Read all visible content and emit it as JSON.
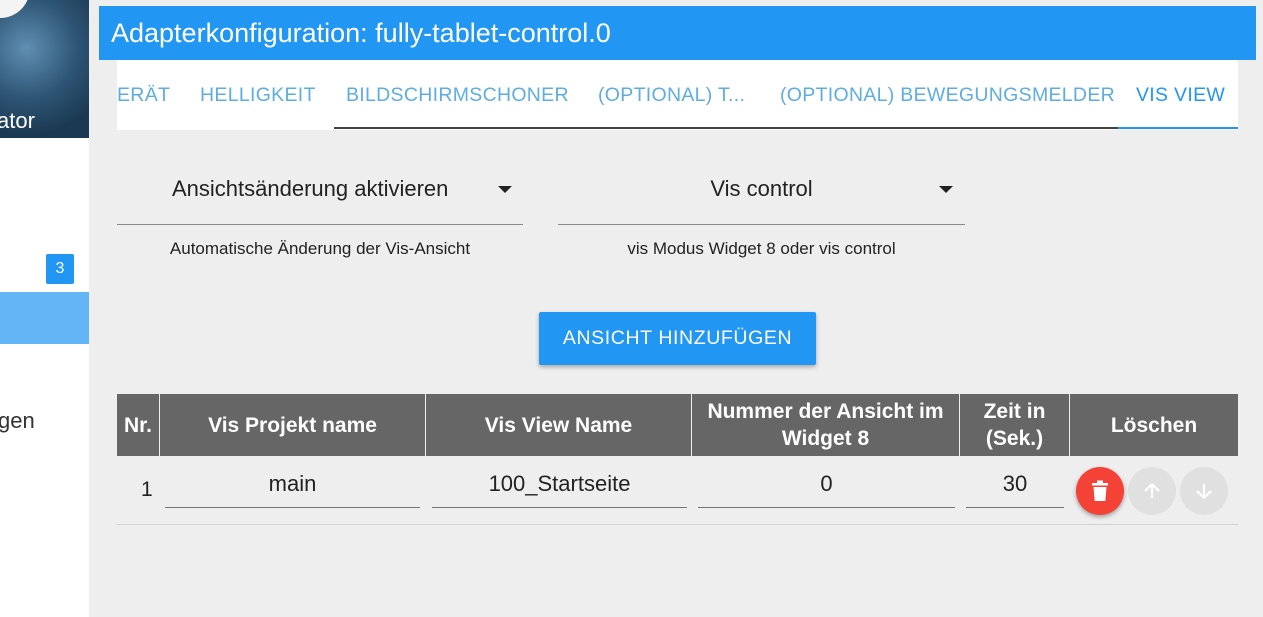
{
  "sidebar": {
    "banner_text": "ator",
    "badge_count": "3",
    "partial_menu_text": "gen"
  },
  "window": {
    "title": "Adapterkonfiguration: fully-tablet-control.0"
  },
  "tabs": [
    {
      "label": "ERÄT"
    },
    {
      "label": "HELLIGKEIT"
    },
    {
      "label": "BILDSCHIRMSCHONER"
    },
    {
      "label": "(OPTIONAL) T..."
    },
    {
      "label": "(OPTIONAL) BEWEGUNGSMELDER"
    },
    {
      "label": "VIS VIEW",
      "active": true
    }
  ],
  "form": {
    "view_change": {
      "value": "Ansichtsänderung aktivieren",
      "helper": "Automatische Änderung der Vis-Ansicht"
    },
    "vis_mode": {
      "value": "Vis control",
      "helper": "vis Modus Widget 8 oder vis control"
    },
    "add_button_label": "ANSICHT HINZUFÜGEN"
  },
  "table": {
    "headers": [
      "Nr.",
      "Vis Projekt name",
      "Vis View Name",
      "Nummer der Ansicht im Widget 8",
      "Zeit in (Sek.)",
      "Löschen"
    ],
    "rows": [
      {
        "nr": "1",
        "project": "main",
        "view": "100_Startseite",
        "widget_number": "0",
        "time": "30"
      }
    ]
  },
  "colors": {
    "primary": "#2196f3",
    "tab_text": "#5dade2",
    "header_bg": "#666666",
    "delete": "#f44336",
    "disabled": "#e0e0e0"
  },
  "icons": [
    "delete-icon",
    "arrow-up-icon",
    "arrow-down-icon",
    "dropdown-arrow-icon"
  ]
}
